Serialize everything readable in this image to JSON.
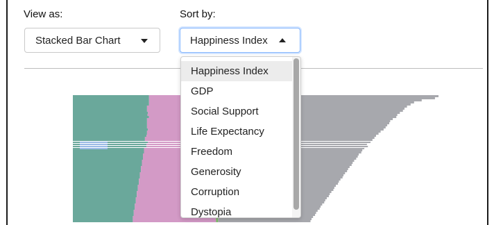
{
  "controls": {
    "view_as_label": "View as:",
    "view_as_value": "Stacked Bar Chart",
    "sort_by_label": "Sort by:",
    "sort_by_value": "Happiness Index"
  },
  "dropdown": {
    "selected_index": 0,
    "options": [
      "Happiness Index",
      "GDP",
      "Social Support",
      "Life Expectancy",
      "Freedom",
      "Generosity",
      "Corruption",
      "Dystopia"
    ]
  },
  "colors": {
    "gdp": "#6aa89b",
    "social_support": "#d39ac6",
    "life_expectancy": "#f2a985",
    "freedom": "#7fbf6a",
    "generosity": "#f0c97a",
    "corruption": "#9bbbe6",
    "dystopia": "#a7a8ad",
    "selected_row": "#ececec",
    "focus_border": "#86b7fe"
  },
  "chart_data": {
    "type": "bar",
    "orientation": "horizontal",
    "stacked": true,
    "series": [
      {
        "key": "gdp",
        "values": [
          1.5,
          1.5,
          1.5,
          1.5,
          1.5,
          1.46,
          1.46,
          1.46,
          1.48,
          1.47,
          1.5,
          1.46,
          1.46,
          1.46,
          1.46,
          1.46,
          1.48,
          1.46,
          1.46,
          1.45,
          1.42,
          1.42,
          1.48,
          1.45,
          1.45,
          1.4,
          1.4,
          1.4,
          1.38,
          1.38,
          1.38,
          1.36,
          1.36,
          1.36,
          1.34,
          1.34,
          1.34,
          1.32,
          1.32,
          1.32,
          1.3,
          1.3,
          1.3,
          1.28,
          1.28,
          1.28,
          1.26,
          1.26,
          1.26,
          1.24,
          1.24,
          1.24,
          1.22,
          1.22,
          1.22,
          1.2,
          1.2,
          1.2,
          1.18,
          1.18,
          1.18
        ]
      },
      {
        "key": "social_support",
        "values": [
          1.9,
          1.88,
          1.86,
          1.87,
          1.86,
          1.88,
          1.88,
          1.86,
          1.84,
          1.82,
          1.78,
          1.8,
          1.8,
          1.8,
          1.79,
          1.8,
          1.8,
          1.78,
          1.76,
          1.76,
          1.78,
          1.8,
          1.72,
          1.7,
          1.74,
          1.76,
          1.76,
          1.76,
          1.75,
          1.75,
          1.74,
          1.74,
          1.73,
          1.73,
          1.73,
          1.72,
          1.72,
          1.72,
          1.71,
          1.71,
          1.71,
          1.7,
          1.7,
          1.7,
          1.69,
          1.69,
          1.69,
          1.68,
          1.68,
          1.68,
          1.67,
          1.67,
          1.67,
          1.66,
          1.66,
          1.66,
          1.65,
          1.65,
          1.65,
          1.64,
          1.64
        ]
      },
      {
        "key": "freedom",
        "values": [
          0.1,
          0.1,
          0.06,
          0.05,
          0.04,
          0.04,
          0.04,
          0.04,
          0.04,
          0.04,
          0.04,
          0.04,
          0.04,
          0.04,
          0.04,
          0.04,
          0.04,
          0.04,
          0.04,
          0.04,
          0.04,
          0.04,
          0.04,
          0.04,
          0.04,
          0.04,
          0.04,
          0.04,
          0.04,
          0.04,
          0.04,
          0.04,
          0.04,
          0.04,
          0.04,
          0.04,
          0.04,
          0.04,
          0.04,
          0.04,
          0.04,
          0.04,
          0.04,
          0.04,
          0.04,
          0.04,
          0.04,
          0.04,
          0.04,
          0.04,
          0.04,
          0.04,
          0.04,
          0.04,
          0.04,
          0.04,
          0.04,
          0.04,
          0.04,
          0.04,
          0.04
        ]
      },
      {
        "key": "dystopia",
        "values": [
          3.7,
          3.65,
          3.45,
          3.3,
          3.25,
          3.2,
          3.15,
          3.14,
          3.08,
          3.06,
          3.05,
          3.0,
          2.95,
          2.93,
          2.9,
          2.86,
          2.8,
          2.78,
          2.76,
          2.72,
          2.7,
          2.64,
          2.62,
          2.6,
          2.58,
          2.54,
          2.5,
          2.48,
          2.46,
          2.44,
          2.42,
          2.4,
          2.38,
          2.36,
          2.34,
          2.32,
          2.3,
          2.28,
          2.26,
          2.24,
          2.22,
          2.2,
          2.18,
          2.16,
          2.14,
          2.12,
          2.1,
          2.08,
          2.06,
          2.04,
          2.02,
          2.0,
          1.98,
          1.96,
          1.94,
          1.92,
          1.9,
          1.88,
          1.86,
          1.84,
          1.82
        ]
      }
    ],
    "highlight_rows": [
      {
        "index": 22,
        "color_key": "corruption"
      },
      {
        "index": 23,
        "color_key": "corruption"
      },
      {
        "index": 25,
        "color_key": "corruption"
      },
      {
        "index": 24,
        "color_key": "corruption"
      }
    ]
  }
}
